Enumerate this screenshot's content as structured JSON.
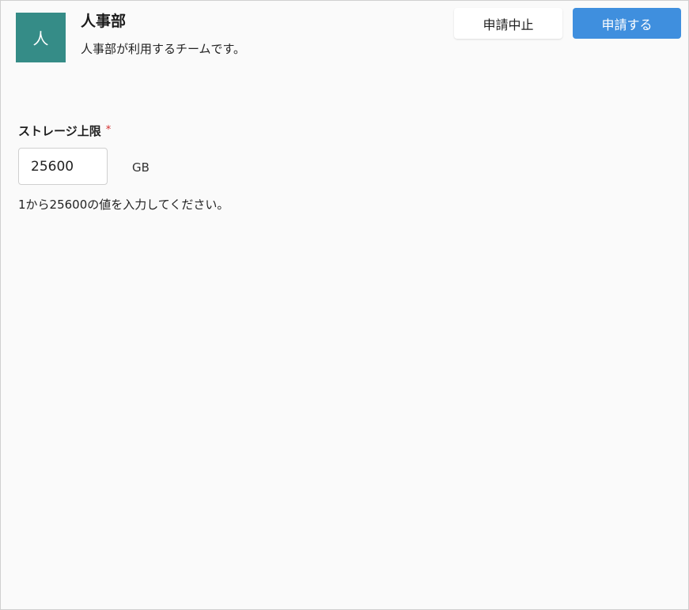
{
  "team": {
    "avatar_letter": "人",
    "title": "人事部",
    "description": "人事部が利用するチームです。"
  },
  "actions": {
    "cancel_label": "申請中止",
    "apply_label": "申請する"
  },
  "storage": {
    "label": "ストレージ上限",
    "required_mark": "*",
    "value": "25600",
    "unit": "GB",
    "hint": "1から25600の値を入力してください。"
  },
  "colors": {
    "avatar_bg": "#358c87",
    "primary": "#3f8fde",
    "required": "#d32f2f",
    "background": "#fafafa"
  }
}
